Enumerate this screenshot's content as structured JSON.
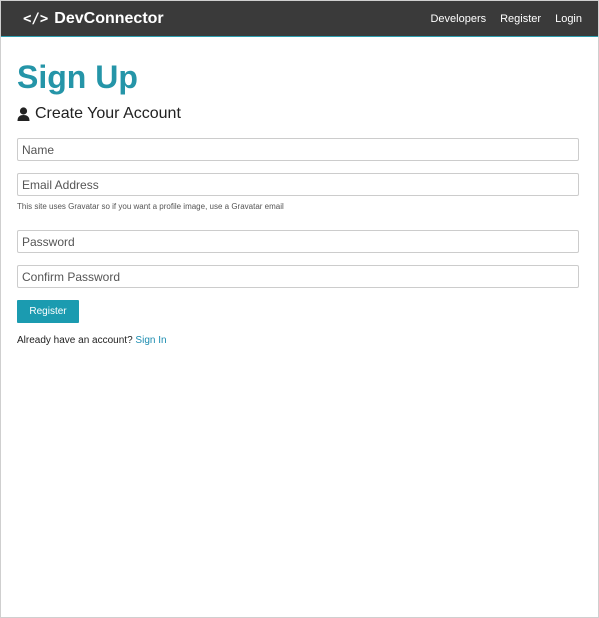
{
  "nav": {
    "brand": "DevConnector",
    "brand_icon": "code-icon",
    "brand_icon_glyph": "</>",
    "links": [
      "Developers",
      "Register",
      "Login"
    ]
  },
  "page": {
    "title": "Sign Up",
    "subtitle": "Create Your Account",
    "subtitle_icon": "user-icon"
  },
  "form": {
    "name_placeholder": "Name",
    "email_placeholder": "Email Address",
    "email_hint": "This site uses Gravatar so if you want a profile image, use a Gravatar email",
    "password_placeholder": "Password",
    "confirm_password_placeholder": "Confirm Password",
    "submit_label": "Register"
  },
  "footer": {
    "prompt": "Already have an account?",
    "link": "Sign In"
  },
  "colors": {
    "navbar": "#3a3a3a",
    "accent": "#2595a8",
    "button": "#1b9bb0",
    "link": "#1b8cb0"
  }
}
